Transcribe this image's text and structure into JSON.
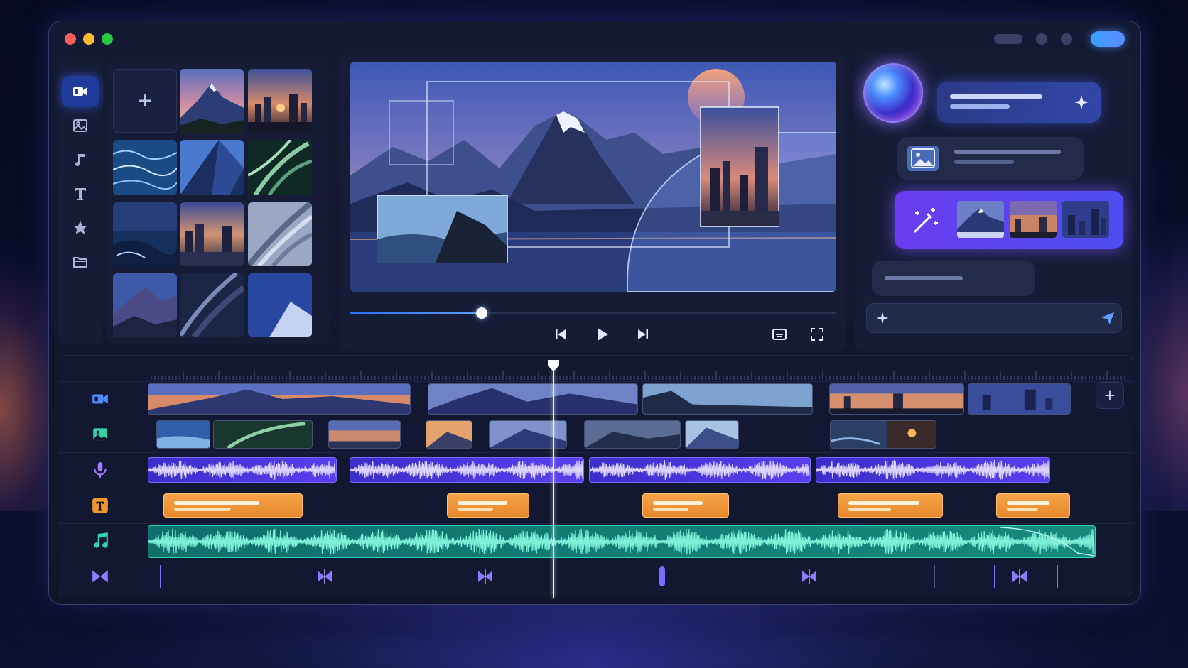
{
  "window": {
    "controls": [
      "close",
      "minimize",
      "maximize"
    ]
  },
  "toolbar": {
    "accent_color": "#3aa0ff"
  },
  "rail": {
    "items": [
      {
        "icon": "video-icon",
        "active": true
      },
      {
        "icon": "image-icon",
        "active": false
      },
      {
        "icon": "music-icon",
        "active": false
      },
      {
        "icon": "text-icon",
        "active": false
      },
      {
        "icon": "star-icon",
        "active": false
      },
      {
        "icon": "folder-icon",
        "active": false
      }
    ]
  },
  "library": {
    "add_label": "+",
    "thumbnails": [
      "mountain-sunset",
      "city-skyline-dusk",
      "ocean-waves",
      "glass-building",
      "tropical-leaves",
      "deep-sea",
      "city-night-reflection",
      "curved-architecture",
      "mountain-range",
      "dark-curves",
      "snowy-peak"
    ]
  },
  "preview": {
    "progress": 0.27
  },
  "assistant": {
    "input_placeholder": "",
    "generated_thumbnails": [
      "mountain",
      "sunset-city",
      "night-city"
    ]
  },
  "timeline": {
    "add_track_label": "+",
    "playhead_position": 0.42,
    "tracks": [
      "video",
      "image",
      "voice",
      "text",
      "music",
      "transition"
    ],
    "colors": {
      "audio": "#5a3ef0",
      "text": "#f0972f",
      "music": "#16897e"
    }
  }
}
